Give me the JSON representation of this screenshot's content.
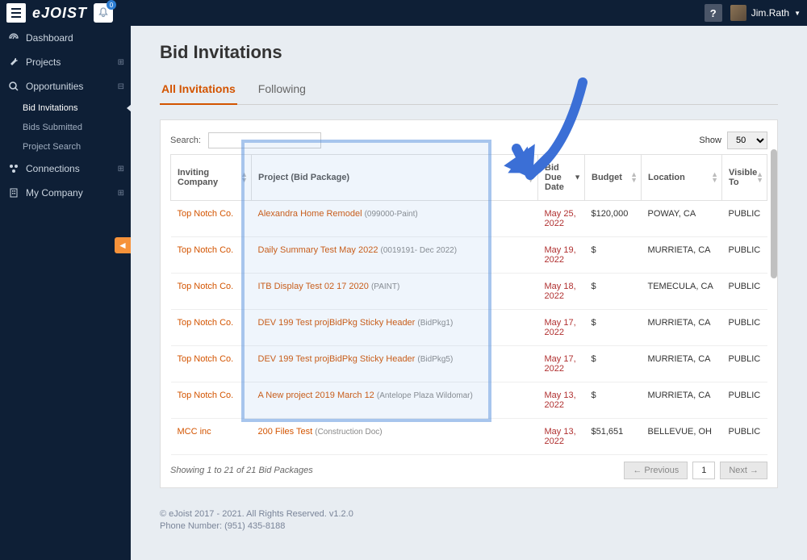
{
  "topbar": {
    "logo": "eJOIST",
    "notif_count": "0",
    "help": "?",
    "username": "Jim.Rath"
  },
  "sidebar": {
    "items": [
      {
        "label": "Dashboard",
        "icon": "dashboard"
      },
      {
        "label": "Projects",
        "icon": "wrench",
        "expandable": true
      },
      {
        "label": "Opportunities",
        "icon": "search",
        "expandable": true,
        "expanded": true
      },
      {
        "label": "Connections",
        "icon": "connections",
        "expandable": true
      },
      {
        "label": "My Company",
        "icon": "building",
        "expandable": true
      }
    ],
    "opportunities_sub": [
      {
        "label": "Bid Invitations",
        "active": true
      },
      {
        "label": "Bids Submitted"
      },
      {
        "label": "Project Search"
      }
    ]
  },
  "page": {
    "title": "Bid Invitations",
    "tabs": [
      {
        "label": "All Invitations",
        "active": true
      },
      {
        "label": "Following"
      }
    ],
    "search_label": "Search:",
    "show_label": "Show",
    "show_value": "50",
    "columns": [
      "Inviting Company",
      "Project (Bid Package)",
      "Bid Due Date",
      "Budget",
      "Location",
      "Visible To"
    ],
    "rows": [
      {
        "company": "Top Notch Co.",
        "project": "Alexandra Home Remodel",
        "pkg": "(099000-Paint)",
        "due": "May 25, 2022",
        "budget": "$120,000",
        "location": "POWAY, CA",
        "visible": "PUBLIC"
      },
      {
        "company": "Top Notch Co.",
        "project": "Daily Summary Test May 2022",
        "pkg": "(0019191- Dec 2022)",
        "due": "May 19, 2022",
        "budget": "$",
        "location": "MURRIETA, CA",
        "visible": "PUBLIC"
      },
      {
        "company": "Top Notch Co.",
        "project": "ITB Display Test 02 17 2020",
        "pkg": "(PAINT)",
        "due": "May 18, 2022",
        "budget": "$",
        "location": "TEMECULA, CA",
        "visible": "PUBLIC"
      },
      {
        "company": "Top Notch Co.",
        "project": "DEV 199 Test projBidPkg Sticky Header",
        "pkg": "(BidPkg1)",
        "due": "May 17, 2022",
        "budget": "$",
        "location": "MURRIETA, CA",
        "visible": "PUBLIC"
      },
      {
        "company": "Top Notch Co.",
        "project": "DEV 199 Test projBidPkg Sticky Header",
        "pkg": "(BidPkg5)",
        "due": "May 17, 2022",
        "budget": "$",
        "location": "MURRIETA, CA",
        "visible": "PUBLIC"
      },
      {
        "company": "Top Notch Co.",
        "project": "A New project 2019 March 12",
        "pkg": "(Antelope Plaza Wildomar)",
        "due": "May 13, 2022",
        "budget": "$",
        "location": "MURRIETA, CA",
        "visible": "PUBLIC"
      },
      {
        "company": "MCC inc",
        "project": "200 Files Test",
        "pkg": "(Construction Doc)",
        "due": "May 13, 2022",
        "budget": "$51,651",
        "location": "BELLEVUE, OH",
        "visible": "PUBLIC"
      }
    ],
    "showing": "Showing 1 to 21 of 21 Bid Packages",
    "prev": "Previous",
    "next": "Next",
    "page_num": "1"
  },
  "footer": {
    "copyright": "© eJoist 2017 - 2021. All Rights Reserved. v1.2.0",
    "phone": "Phone Number: (951) 435-8188"
  }
}
